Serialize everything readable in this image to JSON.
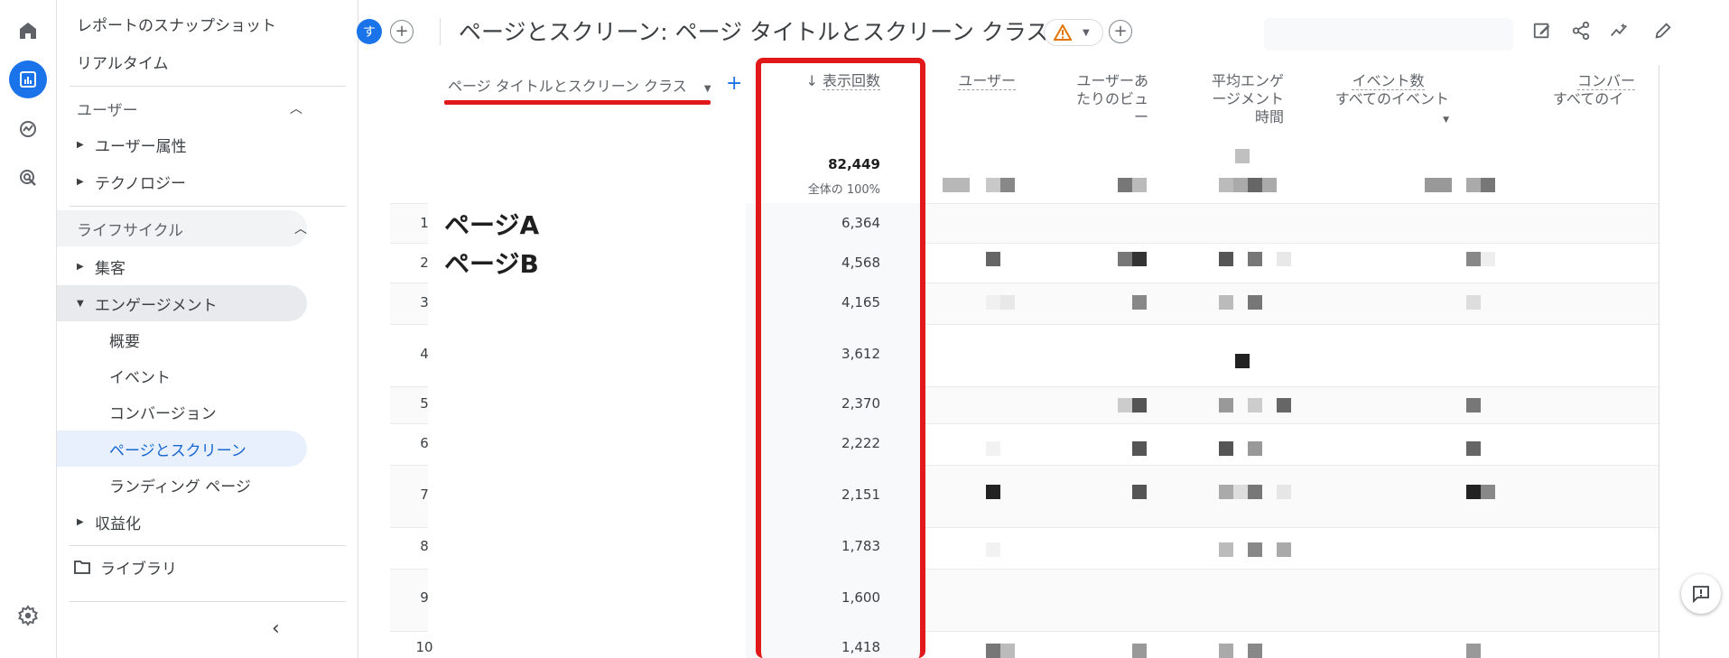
{
  "sidebar": {
    "items": {
      "snapshot": "レポートのスナップショット",
      "realtime": "リアルタイム",
      "user_section": "ユーザー",
      "user_attributes": "ユーザー属性",
      "technology": "テクノロジー",
      "lifecycle_section": "ライフサイクル",
      "acquisition": "集客",
      "engagement": "エンゲージメント",
      "overview": "概要",
      "events": "イベント",
      "conversions": "コンバージョン",
      "pages_screens": "ページとスクリーン",
      "landing_page": "ランディング ページ",
      "monetization": "収益化",
      "library": "ライブラリ"
    }
  },
  "header": {
    "avatar_initial": "す",
    "title": "ページとスクリーン: ページ タイトルとスクリーン クラス"
  },
  "table": {
    "dimension_header": "ページ タイトルとスクリーン クラス",
    "columns": {
      "views": "表示回数",
      "users": "ユーザー",
      "views_per_user_1": "ユーザーあ",
      "views_per_user_2": "たりのビュ",
      "views_per_user_3": "ー",
      "avg_engagement_1": "平均エンゲ",
      "avg_engagement_2": "ージメント",
      "avg_engagement_3": "時間",
      "event_count": "イベント数",
      "event_filter": "すべてのイベント",
      "conversions": "コンバー",
      "conversions_filter": "すべてのイ"
    },
    "total_views": "82,449",
    "total_pct": "全体の 100%",
    "rows": [
      {
        "num": "1",
        "page": "ページA",
        "views": "6,364"
      },
      {
        "num": "2",
        "page": "ページB",
        "views": "4,568"
      },
      {
        "num": "3",
        "page": "",
        "views": "4,165"
      },
      {
        "num": "4",
        "page": "",
        "views": "3,612"
      },
      {
        "num": "5",
        "page": "",
        "views": "2,370"
      },
      {
        "num": "6",
        "page": "",
        "views": "2,222"
      },
      {
        "num": "7",
        "page": "",
        "views": "2,151"
      },
      {
        "num": "8",
        "page": "",
        "views": "1,783"
      },
      {
        "num": "9",
        "page": "",
        "views": "1,600"
      },
      {
        "num": "10",
        "page": "",
        "views": "1,418"
      }
    ]
  },
  "colors": {
    "accent": "#1a73e8",
    "highlight": "#e2191a"
  }
}
